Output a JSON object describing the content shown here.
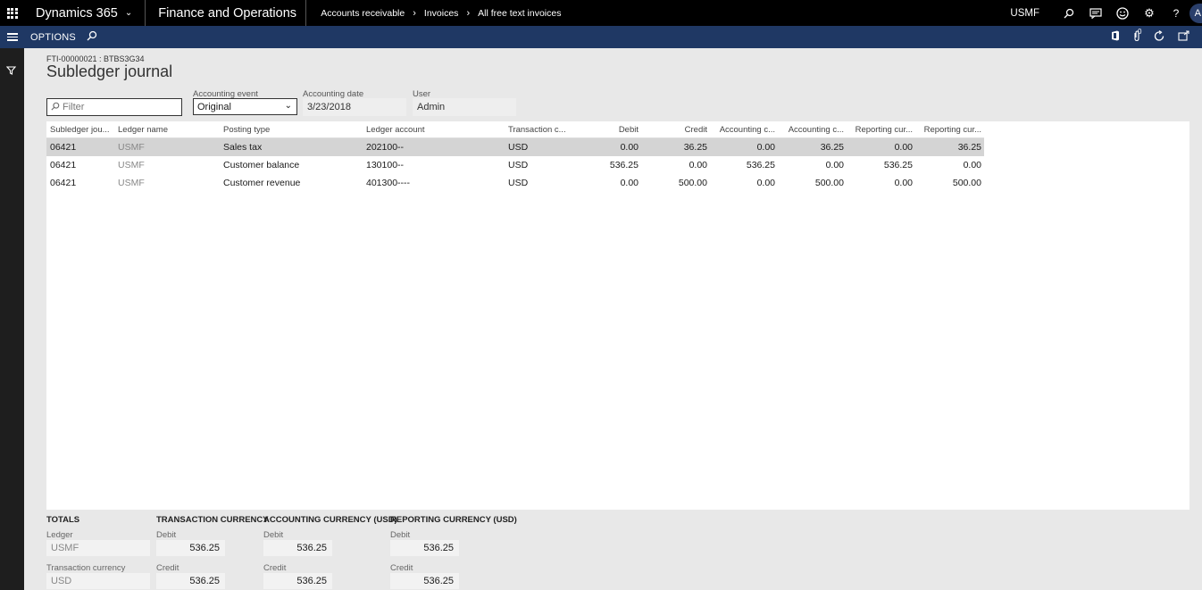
{
  "topbar": {
    "app_name": "Dynamics 365",
    "module_name": "Finance and Operations",
    "breadcrumb": [
      "Accounts receivable",
      "Invoices",
      "All free text invoices"
    ],
    "company": "USMF",
    "avatar_initial": "A"
  },
  "actionbar": {
    "options_label": "OPTIONS",
    "notification_count": "0"
  },
  "page": {
    "caption": "FTI-00000021 : BTBS3G34",
    "title": "Subledger journal"
  },
  "filters": {
    "filter_placeholder": "Filter",
    "accounting_event_label": "Accounting event",
    "accounting_event_value": "Original",
    "accounting_date_label": "Accounting date",
    "accounting_date_value": "3/23/2018",
    "user_label": "User",
    "user_value": "Admin"
  },
  "grid": {
    "columns": [
      "Subledger jou...",
      "Ledger name",
      "Posting type",
      "Ledger account",
      "Transaction c...",
      "Debit",
      "Credit",
      "Accounting c...",
      "Accounting c...",
      "Reporting cur...",
      "Reporting cur..."
    ],
    "rows": [
      [
        "06421",
        "USMF",
        "Sales tax",
        "202100--",
        "USD",
        "0.00",
        "36.25",
        "0.00",
        "36.25",
        "0.00",
        "36.25"
      ],
      [
        "06421",
        "USMF",
        "Customer balance",
        "130100--",
        "USD",
        "536.25",
        "0.00",
        "536.25",
        "0.00",
        "536.25",
        "0.00"
      ],
      [
        "06421",
        "USMF",
        "Customer revenue",
        "401300----",
        "USD",
        "0.00",
        "500.00",
        "0.00",
        "500.00",
        "0.00",
        "500.00"
      ]
    ]
  },
  "totals": {
    "title": "TOTALS",
    "ledger_label": "Ledger",
    "ledger_value": "USMF",
    "transaction_currency_label": "Transaction currency",
    "transaction_currency_value": "USD",
    "groups": [
      {
        "heading": "TRANSACTION CURRENCY",
        "debit_label": "Debit",
        "debit": "536.25",
        "credit_label": "Credit",
        "credit": "536.25"
      },
      {
        "heading": "ACCOUNTING CURRENCY (USD)",
        "debit_label": "Debit",
        "debit": "536.25",
        "credit_label": "Credit",
        "credit": "536.25"
      },
      {
        "heading": "REPORTING CURRENCY (USD)",
        "debit_label": "Debit",
        "debit": "536.25",
        "credit_label": "Credit",
        "credit": "536.25"
      }
    ]
  }
}
